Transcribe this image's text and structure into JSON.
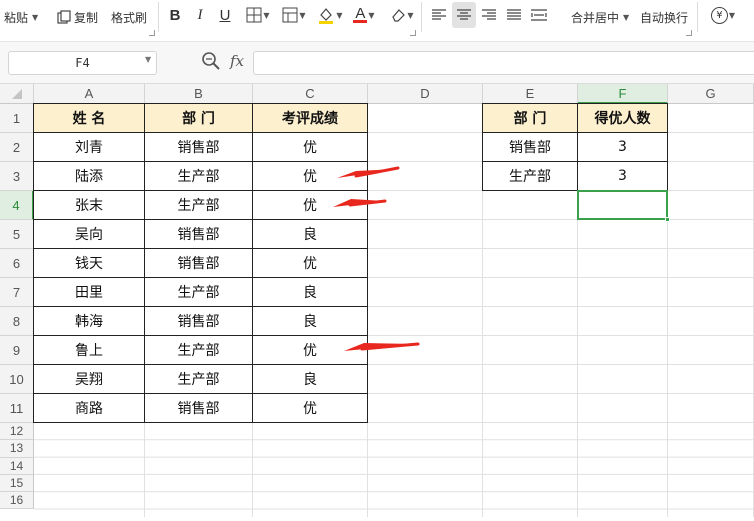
{
  "toolbar": {
    "paste_label": "粘贴",
    "copy_label": "复制",
    "format_painter_label": "格式刷",
    "bold_label": "B",
    "italic_label": "I",
    "underline_label": "U",
    "font_color_glyph": "A",
    "merge_center_label": "合并居中",
    "wrap_text_label": "自动换行",
    "currency_glyph": "¥"
  },
  "formula_bar": {
    "name_box": "F4",
    "fx_label": "fx",
    "formula": ""
  },
  "columns": [
    "A",
    "B",
    "C",
    "D",
    "E",
    "F",
    "G"
  ],
  "rows": [
    "1",
    "2",
    "3",
    "4",
    "5",
    "6",
    "7",
    "8",
    "9",
    "10",
    "11",
    "12",
    "13",
    "14",
    "15",
    "16"
  ],
  "selected_cell": "F4",
  "table1": {
    "headers": [
      "姓  名",
      "部  门",
      "考评成绩"
    ],
    "rows": [
      [
        "刘青",
        "销售部",
        "优"
      ],
      [
        "陆添",
        "生产部",
        "优"
      ],
      [
        "张末",
        "生产部",
        "优"
      ],
      [
        "吴向",
        "销售部",
        "良"
      ],
      [
        "钱天",
        "销售部",
        "优"
      ],
      [
        "田里",
        "生产部",
        "良"
      ],
      [
        "韩海",
        "销售部",
        "良"
      ],
      [
        "鲁上",
        "生产部",
        "优"
      ],
      [
        "吴翔",
        "生产部",
        "良"
      ],
      [
        "商路",
        "销售部",
        "优"
      ]
    ]
  },
  "table2": {
    "headers": [
      "部  门",
      "得优人数"
    ],
    "rows": [
      [
        "销售部",
        "3"
      ],
      [
        "生产部",
        "3"
      ]
    ]
  },
  "colors": {
    "header_fill": "#fcf0cf",
    "selection_green": "#3aa04a",
    "arrow_red": "#e8281e"
  }
}
